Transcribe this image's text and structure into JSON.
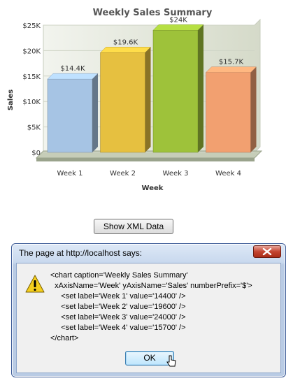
{
  "chart_data": {
    "type": "bar",
    "title": "Weekly Sales Summary",
    "xlabel": "Week",
    "ylabel": "Sales",
    "number_prefix": "$",
    "categories": [
      "Week 1",
      "Week 2",
      "Week 3",
      "Week 4"
    ],
    "values": [
      14400,
      19600,
      24000,
      15700
    ],
    "value_labels": [
      "$14.4K",
      "$19.6K",
      "$24K",
      "$15.7K"
    ],
    "y_ticks": [
      0,
      5000,
      10000,
      15000,
      20000,
      25000
    ],
    "y_tick_labels": [
      "$0",
      "$5K",
      "$10K",
      "$15K",
      "$20K",
      "$25K"
    ],
    "ylim": [
      0,
      25000
    ],
    "grid": true,
    "colors": [
      "#a6c4e4",
      "#e6c040",
      "#9ec23a",
      "#f2a070"
    ]
  },
  "show_xml_button": {
    "label": "Show XML Data"
  },
  "alert": {
    "title": "The page at http://localhost says:",
    "close_icon": "close-x-icon",
    "warning_icon": "warning-icon",
    "message": "<chart caption='Weekly Sales Summary'\n  xAxisName='Week' yAxisName='Sales' numberPrefix='$'>\n     <set label='Week 1' value='14400' />\n     <set label='Week 2' value='19600' />\n     <set label='Week 3' value='24000' />\n     <set label='Week 4' value='15700' />\n</chart>",
    "ok_label": "OK"
  }
}
